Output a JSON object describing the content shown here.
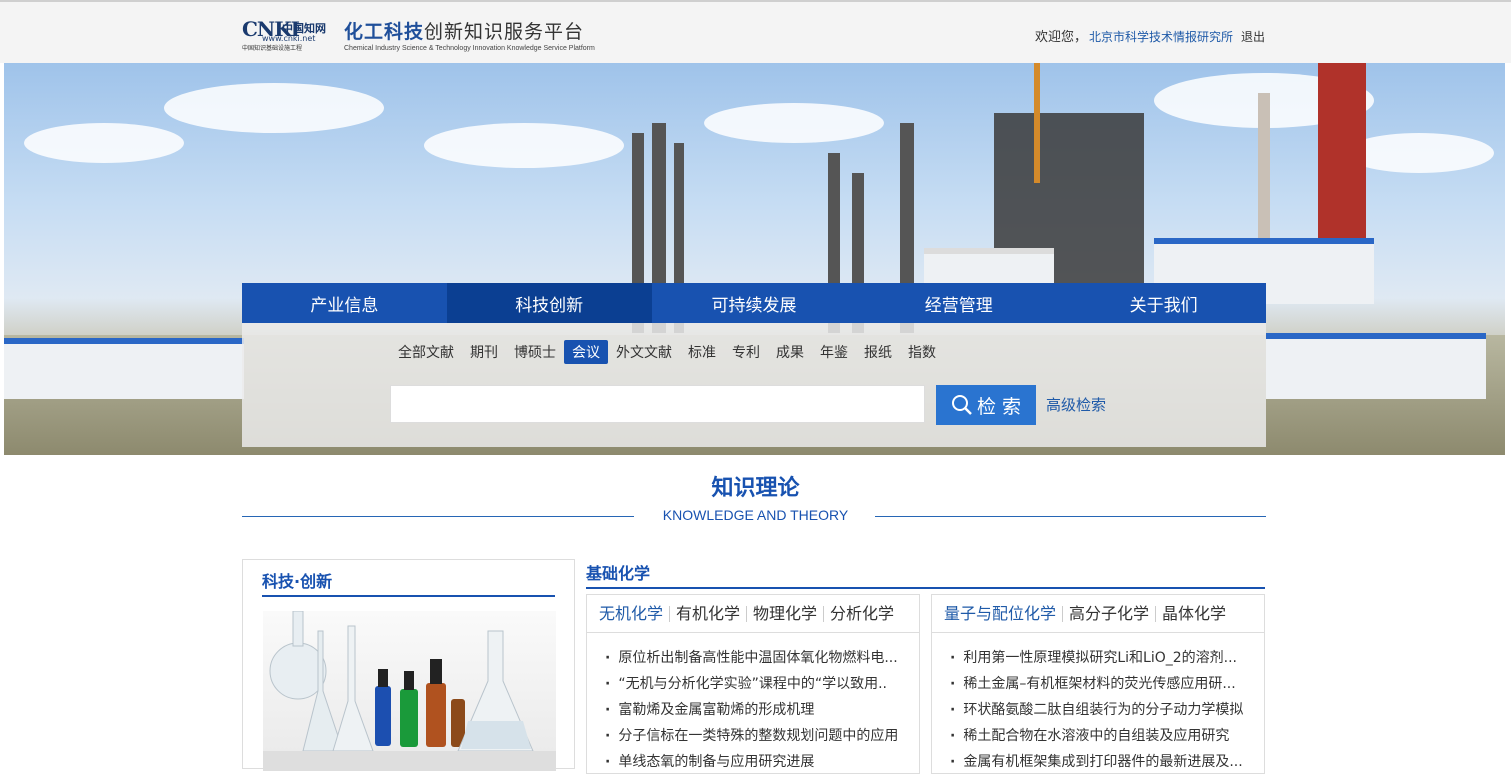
{
  "header": {
    "logo_mark": "CNKI",
    "logo_cn": "中国知网",
    "logo_url": "www.cnki.net",
    "logo_sub": "中国知识基础设施工程",
    "title_highlight": "化工科技",
    "title_rest": "创新知识服务平台",
    "title_en": "Chemical Industry Science & Technology Innovation Knowledge Service Platform",
    "welcome": "欢迎您，",
    "org": "北京市科学技术情报研究所",
    "logout": "退出"
  },
  "nav": {
    "tabs": [
      "产业信息",
      "科技创新",
      "可持续发展",
      "经营管理",
      "关于我们"
    ],
    "active_tab": "科技创新",
    "subtabs": [
      "全部文献",
      "期刊",
      "博硕士",
      "会议",
      "外文文献",
      "标准",
      "专利",
      "成果",
      "年鉴",
      "报纸",
      "指数"
    ],
    "active_subtab": "会议",
    "search_button": "检 索",
    "advanced": "高级检索"
  },
  "section": {
    "title": "知识理论",
    "subtitle": "KNOWLEDGE AND THEORY"
  },
  "left_panel": {
    "title": "科技·创新"
  },
  "basic": {
    "title": "基础化学",
    "card1": {
      "tabs": [
        "无机化学",
        "有机化学",
        "物理化学",
        "分析化学"
      ],
      "active": "无机化学",
      "items": [
        "原位析出制备高性能中温固体氧化物燃料电...",
        "“无机与分析化学实验”课程中的“学以致用..",
        "富勒烯及金属富勒烯的形成机理",
        "分子信标在一类特殊的整数规划问题中的应用",
        "单线态氧的制备与应用研究进展"
      ]
    },
    "card2": {
      "tabs": [
        "量子与配位化学",
        "高分子化学",
        "晶体化学"
      ],
      "active": "量子与配位化学",
      "items": [
        "利用第一性原理模拟研究Li和LiO_2的溶剂...",
        "稀土金属–有机框架材料的荧光传感应用研...",
        "环状酪氨酸二肽自组装行为的分子动力学模拟",
        "稀土配合物在水溶液中的自组装及应用研究",
        "金属有机框架集成到打印器件的最新进展及..."
      ]
    }
  },
  "colors": {
    "brand": "#1852b0",
    "accent": "#2a74d0"
  }
}
